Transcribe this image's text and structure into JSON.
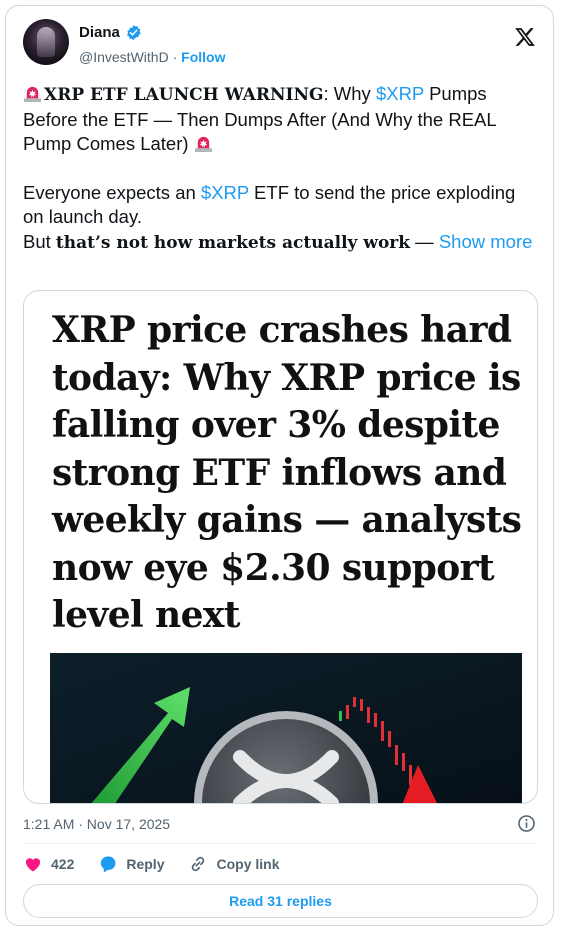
{
  "author": {
    "name": "Diana",
    "handle": "@InvestWithD",
    "separator": "·",
    "follow_label": "Follow"
  },
  "tweet": {
    "line1_bold": "XRP ETF LAUNCH WARNING",
    "line1_rest_a": ": Why ",
    "line1_cashtag": "$XRP",
    "line1_rest_b": " Pumps Before the ETF — Then Dumps After (And Why the REAL Pump Comes Later) ",
    "line2_a": "Everyone expects an ",
    "line2_cashtag": "$XRP",
    "line2_b": " ETF to send the price exploding on launch day.",
    "line3_a": "But ",
    "line3_bold": "that’s not how markets actually work",
    "line3_b": " — ",
    "show_more": "Show more"
  },
  "media": {
    "headline": "XRP price crashes hard today: Why XRP price is falling over 3% despite strong ETF inflows and weekly gains — analysts now eye $2.30 support level next"
  },
  "footer": {
    "timestamp": "1:21 AM · Nov 17, 2025",
    "like_count": "422",
    "reply_label": "Reply",
    "copy_link_label": "Copy link",
    "read_replies_label": "Read 31 replies"
  },
  "colors": {
    "accent": "#1d9bf0",
    "like": "#f91880",
    "muted": "#536471",
    "siren": "#e0245e"
  },
  "icons": [
    "verified-badge-icon",
    "x-logo-icon",
    "siren-icon",
    "info-icon",
    "heart-icon",
    "reply-bubble-icon",
    "link-icon"
  ]
}
